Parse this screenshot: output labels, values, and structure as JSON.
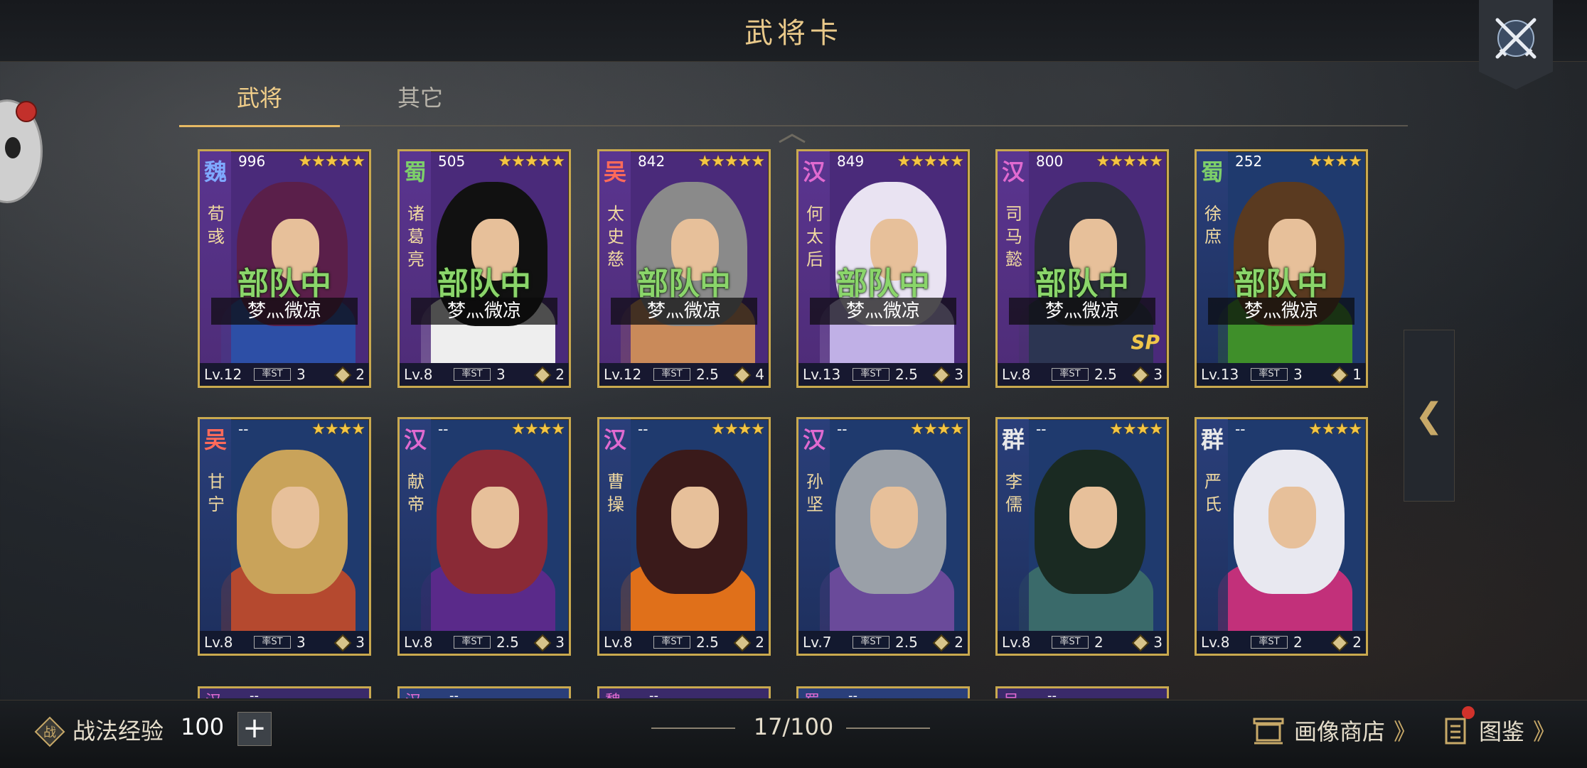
{
  "header": {
    "title": "武将卡"
  },
  "tabs": [
    {
      "label": "武将"
    },
    {
      "label": "其它"
    }
  ],
  "cards": [
    {
      "faction": "魏",
      "faction_color": "#7fa9ff",
      "cost": "996",
      "stars": "★★★★★",
      "name": "荀彧",
      "status": "部队中",
      "owner": "梦灬微凉",
      "level": "Lv.12",
      "rate": "率ST",
      "cost_label": "3",
      "units": "2",
      "frame": "purple",
      "hair": "#5a1f4a",
      "robe": "#2d4fa6"
    },
    {
      "faction": "蜀",
      "faction_color": "#7dcf6a",
      "cost": "505",
      "stars": "★★★★★",
      "name": "诸葛亮",
      "status": "部队中",
      "owner": "梦灬微凉",
      "level": "Lv.8",
      "rate": "率ST",
      "cost_label": "3",
      "units": "2",
      "frame": "purple",
      "hair": "#111111",
      "robe": "#eeeeee"
    },
    {
      "faction": "吴",
      "faction_color": "#ff6a5a",
      "cost": "842",
      "stars": "★★★★★",
      "name": "太史慈",
      "status": "部队中",
      "owner": "梦灬微凉",
      "level": "Lv.12",
      "rate": "率ST",
      "cost_label": "2.5",
      "units": "4",
      "frame": "purple",
      "hair": "#8a8a8a",
      "robe": "#c98a5a"
    },
    {
      "faction": "汉",
      "faction_color": "#e06ad0",
      "cost": "849",
      "stars": "★★★★★",
      "name": "何太后",
      "status": "部队中",
      "owner": "梦灬微凉",
      "level": "Lv.13",
      "rate": "率ST",
      "cost_label": "2.5",
      "units": "3",
      "frame": "purple",
      "hair": "#e9e3f2",
      "robe": "#c0b0e6"
    },
    {
      "faction": "汉",
      "faction_color": "#e06ad0",
      "cost": "800",
      "stars": "★★★★★",
      "name": "司马懿",
      "status": "部队中",
      "owner": "梦灬微凉",
      "level": "Lv.8",
      "rate": "率ST",
      "cost_label": "2.5",
      "units": "3",
      "frame": "purple",
      "hair": "#2a2d38",
      "robe": "#2c3552",
      "sp": "SP"
    },
    {
      "faction": "蜀",
      "faction_color": "#7dcf6a",
      "cost": "252",
      "stars": "★★★★",
      "name": "徐庶",
      "status": "部队中",
      "owner": "梦灬微凉",
      "level": "Lv.13",
      "rate": "率ST",
      "cost_label": "3",
      "units": "1",
      "frame": "blue",
      "hair": "#5a3a20",
      "robe": "#3f8f2a"
    },
    {
      "faction": "吴",
      "faction_color": "#ff6a5a",
      "cost": "--",
      "stars": "★★★★",
      "name": "甘宁",
      "level": "Lv.8",
      "rate": "率ST",
      "cost_label": "3",
      "units": "3",
      "frame": "blue",
      "hair": "#c9a35a",
      "robe": "#b5492f"
    },
    {
      "faction": "汉",
      "faction_color": "#e06ad0",
      "cost": "--",
      "stars": "★★★★",
      "name": "献帝",
      "level": "Lv.8",
      "rate": "率ST",
      "cost_label": "2.5",
      "units": "3",
      "frame": "blue",
      "hair": "#8a2a36",
      "robe": "#5a2a8a"
    },
    {
      "faction": "汉",
      "faction_color": "#e06ad0",
      "cost": "--",
      "stars": "★★★★",
      "name": "曹操",
      "level": "Lv.8",
      "rate": "率ST",
      "cost_label": "2.5",
      "units": "2",
      "frame": "blue",
      "hair": "#3a1a1a",
      "robe": "#e0701a"
    },
    {
      "faction": "汉",
      "faction_color": "#e06ad0",
      "cost": "--",
      "stars": "★★★★",
      "name": "孙坚",
      "level": "Lv.7",
      "rate": "率ST",
      "cost_label": "2.5",
      "units": "2",
      "frame": "blue",
      "hair": "#9aa0a8",
      "robe": "#6a4a9a"
    },
    {
      "faction": "群",
      "faction_color": "#e8e8e8",
      "cost": "--",
      "stars": "★★★★",
      "name": "李儒",
      "level": "Lv.8",
      "rate": "率ST",
      "cost_label": "2",
      "units": "3",
      "frame": "blue",
      "hair": "#1a2a22",
      "robe": "#3a6a6a"
    },
    {
      "faction": "群",
      "faction_color": "#e8e8e8",
      "cost": "--",
      "stars": "★★★★",
      "name": "严氏",
      "level": "Lv.8",
      "rate": "率ST",
      "cost_label": "2",
      "units": "2",
      "frame": "blue",
      "hair": "#e8e8f0",
      "robe": "#c2307a"
    }
  ],
  "partial_cards": [
    {
      "faction": "汉",
      "cost": "--"
    },
    {
      "faction": "汉",
      "cost": "--"
    },
    {
      "faction": "魏",
      "cost": "--"
    },
    {
      "faction": "蜀",
      "cost": "--"
    },
    {
      "faction": "吴",
      "cost": "--"
    }
  ],
  "side_toggle": {
    "label": "❮"
  },
  "footer": {
    "exp_label": "战法经验",
    "exp_value": "100",
    "plus_label": "+",
    "count": "17/100",
    "shop_label": "画像商店",
    "atlas_label": "图鉴",
    "chevron": "》"
  },
  "colors": {
    "accent": "#e6b964",
    "troop_green": "#8ad56a",
    "card_border": "#c9a94f"
  }
}
